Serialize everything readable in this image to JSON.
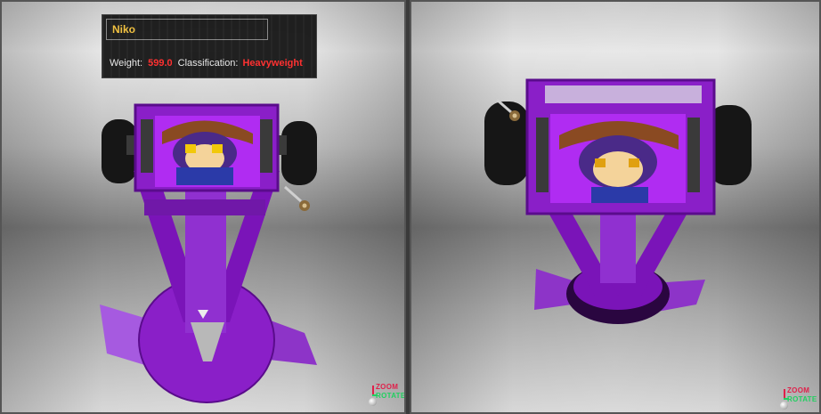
{
  "robot": {
    "name": "Niko",
    "weight_label": "Weight:",
    "weight_value": "599.0",
    "classification_label": "Classification:",
    "classification_value": "Heavyweight"
  },
  "views": {
    "left": {
      "zoom_label": "ZOOM",
      "rotate_label": "ROTATE"
    },
    "right": {
      "zoom_label": "ZOOM",
      "rotate_label": "ROTATE"
    }
  },
  "colors": {
    "chassis": "#8a1fc8",
    "chassis_dark": "#5a0c8c",
    "wedge": "#9b45d6",
    "wheel": "#1a1a1a",
    "name_text": "#f0c040",
    "value_text": "#ff3030"
  },
  "icons": [
    "gear-icon",
    "zoom-axis-icon",
    "rotate-axis-icon"
  ]
}
